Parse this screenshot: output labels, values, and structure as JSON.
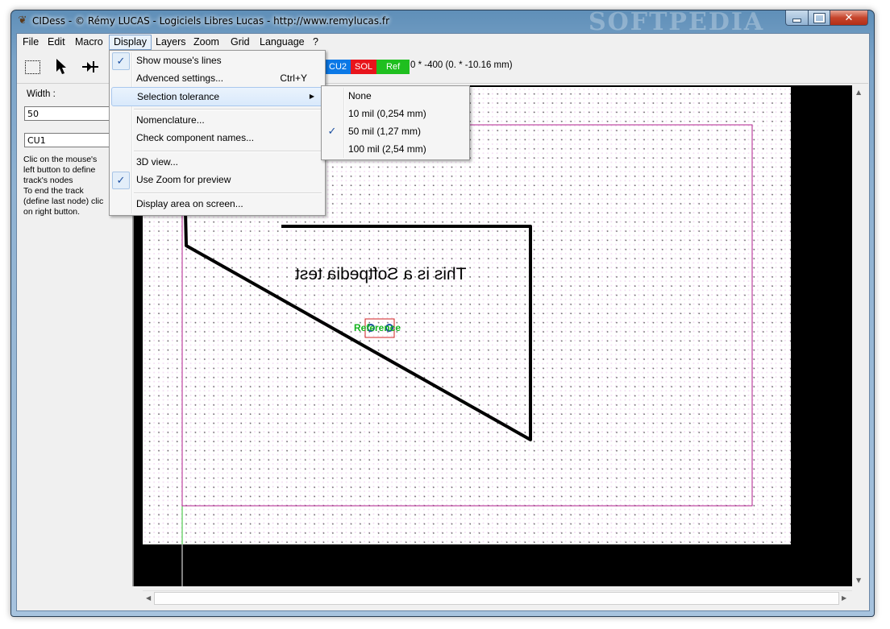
{
  "window": {
    "title": "CIDess - © Rémy LUCAS - Logiciels Libres Lucas - http://www.remylucas.fr",
    "watermark": "SOFTPEDIA"
  },
  "menubar": {
    "items": [
      "File",
      "Edit",
      "Macro",
      "Display",
      "Layers",
      "Zoom",
      "Grid",
      "Language",
      "?"
    ],
    "open_menu": "Display"
  },
  "toolbar": {
    "tools": [
      "select-rectangle-icon",
      "pointer-arrow-icon",
      "track-node-icon"
    ],
    "layers": [
      {
        "label": "CU2",
        "color": "#0b78e6"
      },
      {
        "label": "SOL",
        "color": "#e8141b"
      },
      {
        "label": "Ref",
        "color": "#1fbf1f"
      }
    ],
    "coords": "0 * -400 (0. * -10.16 mm)"
  },
  "left_panel": {
    "width_label": "Width :",
    "width_value": "50",
    "layer_value": "CU1",
    "help_text": "Clic on the mouse's left button to define track's nodes\nTo end the track (define last node) clic on right button."
  },
  "canvas": {
    "text": "This is a Softpedia test",
    "reference_label": "Reference",
    "colors": {
      "track": "#000000",
      "board_outline": "#b0208e",
      "reference": "#15b31e",
      "grid_dot": "#6d6d6d",
      "green_line": "#2ec22e"
    }
  },
  "display_menu": {
    "items": [
      {
        "label": "Show mouse's lines",
        "checked": true,
        "shortcut": ""
      },
      {
        "label": "Advenced settings...",
        "checked": false,
        "shortcut": "Ctrl+Y"
      },
      {
        "label": "Selection tolerance",
        "checked": false,
        "shortcut": "",
        "submenu": true,
        "highlighted": true
      },
      {
        "label": "Nomenclature...",
        "checked": false,
        "shortcut": ""
      },
      {
        "label": "Check component names...",
        "checked": false,
        "shortcut": ""
      },
      {
        "label": "3D view...",
        "checked": false,
        "shortcut": ""
      },
      {
        "label": "Use Zoom for preview",
        "checked": true,
        "shortcut": ""
      },
      {
        "label": "Display area on screen...",
        "checked": false,
        "shortcut": ""
      }
    ]
  },
  "tolerance_submenu": {
    "items": [
      {
        "label": "None",
        "checked": false
      },
      {
        "label": "10 mil (0,254 mm)",
        "checked": false
      },
      {
        "label": "50 mil (1,27 mm)",
        "checked": true
      },
      {
        "label": "100 mil (2,54 mm)",
        "checked": false
      }
    ]
  }
}
